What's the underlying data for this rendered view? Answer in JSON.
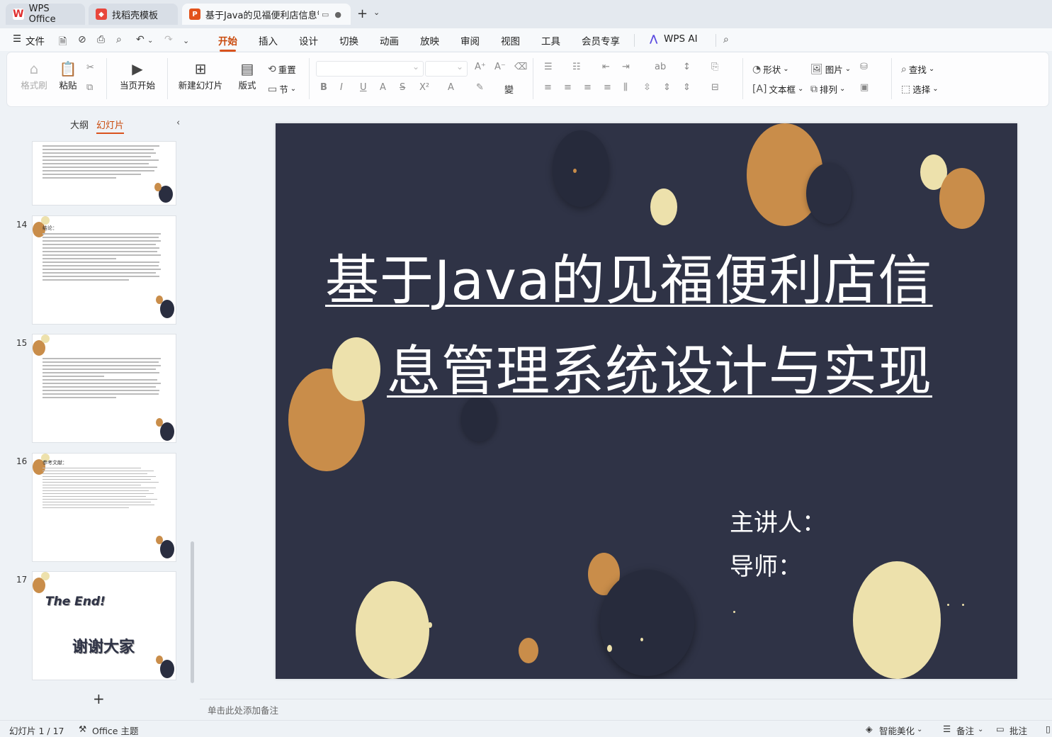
{
  "tabs": [
    {
      "label": "WPS Office",
      "icon": "wps-logo-icon",
      "color": "#e02f2f"
    },
    {
      "label": "找稻壳模板",
      "icon": "docer-icon",
      "color": "#e8463c"
    },
    {
      "label": "基于Java的见福便利店信息管",
      "icon": "presentation-p-icon",
      "color": "#e2521b"
    }
  ],
  "menu": {
    "file": "文件",
    "items": [
      "开始",
      "插入",
      "设计",
      "切换",
      "动画",
      "放映",
      "审阅",
      "视图",
      "工具",
      "会员专享"
    ],
    "ai": "WPS AI",
    "active": "开始"
  },
  "ribbon": {
    "format_painter": "格式刷",
    "paste": "粘贴",
    "from_current": "当页开始",
    "new_slide": "新建幻灯片",
    "layout": "版式",
    "reset": "重置",
    "section": "节",
    "shape": "形状",
    "picture": "图片",
    "find": "查找",
    "textbox": "文本框",
    "arrange": "排列",
    "select": "选择"
  },
  "left_panel": {
    "tab_outline": "大纲",
    "tab_slides": "幻灯片",
    "thumbs": [
      {
        "num": "14",
        "heading": "结论："
      },
      {
        "num": "15",
        "heading": ""
      },
      {
        "num": "16",
        "heading": "参考文献："
      },
      {
        "num": "17",
        "heading": "",
        "text1": "The End!",
        "text2": "谢谢大家"
      }
    ],
    "add": "+"
  },
  "slide": {
    "title_line1": "基于Java的见福便利店信",
    "title_line2": "息管理系统设计与实现",
    "presenter": "主讲人：",
    "advisor": "导师：",
    "bg_color": "#2f3346",
    "accent_brown": "#c98d4a",
    "accent_cream": "#ede1ac",
    "accent_navy": "#2a2e40"
  },
  "notes_placeholder": "单击此处添加备注",
  "status": {
    "slide_counter": "幻灯片 1 / 17",
    "theme": "Office 主题",
    "beautify": "智能美化",
    "notes": "备注",
    "comments": "批注"
  }
}
